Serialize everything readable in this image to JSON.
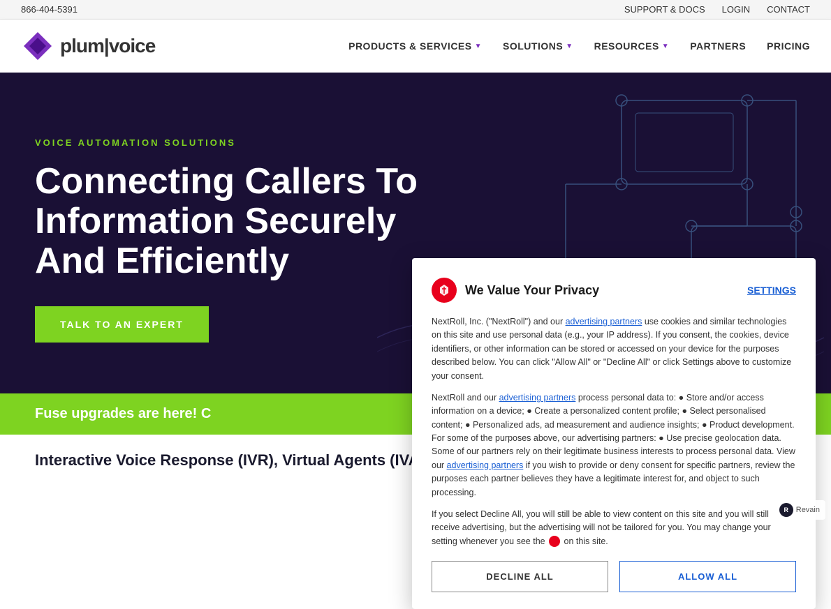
{
  "topbar": {
    "phone": "866-404-5391",
    "support_label": "SUPPORT & DOCS",
    "login_label": "LOGIN",
    "contact_label": "CONTACT"
  },
  "nav": {
    "logo_text_main": "plum",
    "logo_text_accent": "|voice",
    "products_label": "PRODUCTS & SERVICES",
    "solutions_label": "SOLUTIONS",
    "resources_label": "RESOURCES",
    "partners_label": "PARTNERS",
    "pricing_label": "PRICING"
  },
  "hero": {
    "tagline": "VOICE AUTOMATION SOLUTIONS",
    "title": "Connecting Callers To Information Securely And Efficiently",
    "cta_label": "TALK TO AN EXPERT"
  },
  "fuse_banner": {
    "text": "Fuse upgrades are here! C"
  },
  "bottom": {
    "heading": "Interactive Voice Response (IVR), Virtual Agents (IVAs) & Conversational AI"
  },
  "privacy_modal": {
    "title": "We Value Your Privacy",
    "settings_label": "SETTINGS",
    "paragraph1": "NextRoll, Inc. (\"NextRoll\") and our advertising partners use cookies and similar technologies on this site and use personal data (e.g., your IP address). If you consent, the cookies, device identifiers, or other information can be stored or accessed on your device for the purposes described below. You can click \"Allow All\" or \"Decline All\" or click Settings above to customize your consent.",
    "paragraph2": "NextRoll and our advertising partners process personal data to: • Store and/or access information on a device; • Create a personalized content profile; • Select personalised content; • Personalized ads, ad measurement and audience insights; • Product development. For some of the purposes above, our advertising partners: • Use precise geolocation data. Some of our partners rely on their legitimate business interests to process personal data. View our advertising partners if you wish to provide or deny consent for specific partners, review the purposes each partner believes they have a legitimate interest for, and object to such processing.",
    "paragraph3": "If you select Decline All, you will still be able to view content on this site and you will still receive advertising, but the advertising will not be tailored for you. You may change your setting whenever you see the",
    "paragraph3_end": "on this site.",
    "decline_label": "DECLINE ALL",
    "allow_label": "ALLOW ALL",
    "advertising_partners_link": "advertising partners",
    "advertising_partners_link2": "advertising partners",
    "advertising_partners_link3": "advertising partners"
  },
  "revain": {
    "label": "Revain"
  }
}
